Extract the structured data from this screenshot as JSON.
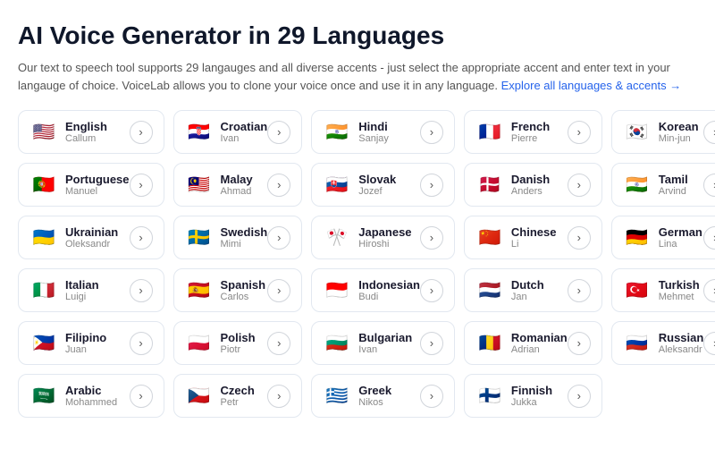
{
  "page": {
    "title": "AI Voice Generator in 29 Languages",
    "subtitle": "Our text to speech tool supports 29 langauges and all diverse accents - just select the appropriate accent and enter text in your langauge of choice. VoiceLab allows you to clone your voice once and use it in any language.",
    "link_text": "Explore all languages & accents →"
  },
  "languages": [
    {
      "name": "English",
      "person": "Callum",
      "flag": "🇺🇸"
    },
    {
      "name": "Croatian",
      "person": "Ivan",
      "flag": "🇭🇷"
    },
    {
      "name": "Hindi",
      "person": "Sanjay",
      "flag": "🇮🇳"
    },
    {
      "name": "French",
      "person": "Pierre",
      "flag": "🇫🇷"
    },
    {
      "name": "Korean",
      "person": "Min-jun",
      "flag": "🇰🇷"
    },
    {
      "name": "Portuguese",
      "person": "Manuel",
      "flag": "🇵🇹"
    },
    {
      "name": "Malay",
      "person": "Ahmad",
      "flag": "🇲🇾"
    },
    {
      "name": "Slovak",
      "person": "Jozef",
      "flag": "🇸🇰"
    },
    {
      "name": "Danish",
      "person": "Anders",
      "flag": "🇩🇰"
    },
    {
      "name": "Tamil",
      "person": "Arvind",
      "flag": "🇮🇳"
    },
    {
      "name": "Ukrainian",
      "person": "Oleksandr",
      "flag": "🇺🇦"
    },
    {
      "name": "Swedish",
      "person": "Mimi",
      "flag": "🇸🇪"
    },
    {
      "name": "Japanese",
      "person": "Hiroshi",
      "flag": "🎌"
    },
    {
      "name": "Chinese",
      "person": "Li",
      "flag": "🇨🇳"
    },
    {
      "name": "German",
      "person": "Lina",
      "flag": "🇩🇪"
    },
    {
      "name": "Italian",
      "person": "Luigi",
      "flag": "🇮🇹"
    },
    {
      "name": "Spanish",
      "person": "Carlos",
      "flag": "🇪🇸"
    },
    {
      "name": "Indonesian",
      "person": "Budi",
      "flag": "🇮🇩"
    },
    {
      "name": "Dutch",
      "person": "Jan",
      "flag": "🇳🇱"
    },
    {
      "name": "Turkish",
      "person": "Mehmet",
      "flag": "🇹🇷"
    },
    {
      "name": "Filipino",
      "person": "Juan",
      "flag": "🇵🇭"
    },
    {
      "name": "Polish",
      "person": "Piotr",
      "flag": "🇵🇱"
    },
    {
      "name": "Bulgarian",
      "person": "Ivan",
      "flag": "🇧🇬"
    },
    {
      "name": "Romanian",
      "person": "Adrian",
      "flag": "🇷🇴"
    },
    {
      "name": "Russian",
      "person": "Aleksandr",
      "flag": "🇷🇺"
    },
    {
      "name": "Arabic",
      "person": "Mohammed",
      "flag": "🇸🇦"
    },
    {
      "name": "Czech",
      "person": "Petr",
      "flag": "🇨🇿"
    },
    {
      "name": "Greek",
      "person": "Nikos",
      "flag": "🇬🇷"
    },
    {
      "name": "Finnish",
      "person": "Jukka",
      "flag": "🇫🇮"
    }
  ],
  "arrow_label": "›"
}
